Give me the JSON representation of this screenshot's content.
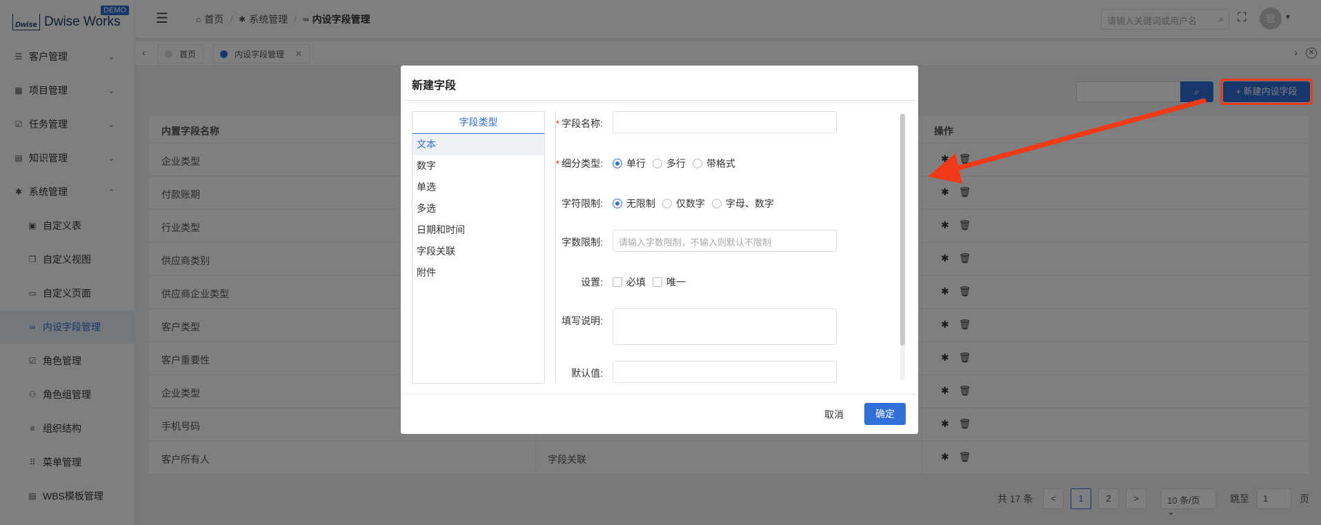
{
  "app": {
    "brand": "Dwise Works",
    "brand_mark": "Dwise",
    "demo_badge": "DEMO"
  },
  "sidebar": {
    "items": [
      {
        "label": "客户管理",
        "icon": "list-icon",
        "chevron": "down"
      },
      {
        "label": "项目管理",
        "icon": "grid-icon",
        "chevron": "down"
      },
      {
        "label": "任务管理",
        "icon": "checkbox-icon",
        "chevron": "down"
      },
      {
        "label": "知识管理",
        "icon": "book-icon",
        "chevron": "down"
      },
      {
        "label": "系统管理",
        "icon": "gear-icon",
        "chevron": "up"
      }
    ],
    "sub_items": [
      {
        "label": "自定义表",
        "icon": "doc-icon"
      },
      {
        "label": "自定义视图",
        "icon": "copy-icon"
      },
      {
        "label": "自定义页面",
        "icon": "window-icon"
      },
      {
        "label": "内设字段管理",
        "icon": "link-icon",
        "active": true
      },
      {
        "label": "角色管理",
        "icon": "check-square-icon"
      },
      {
        "label": "角色组管理",
        "icon": "users-icon"
      },
      {
        "label": "组织结构",
        "icon": "lines-icon"
      },
      {
        "label": "菜单管理",
        "icon": "apps-icon"
      },
      {
        "label": "WBS模板管理",
        "icon": "lock-icon"
      }
    ]
  },
  "header": {
    "breadcrumb": [
      {
        "label": "首页",
        "icon": "home-icon"
      },
      {
        "label": "系统管理",
        "icon": "gear-icon"
      },
      {
        "label": "内设字段管理",
        "icon": "link-icon"
      }
    ],
    "search_placeholder": "请输入关键词或用户名",
    "avatar_text": "管"
  },
  "tabs": [
    {
      "label": "首页"
    },
    {
      "label": "内设字段管理"
    }
  ],
  "toolbar": {
    "new_button": "+ 新建内设字段"
  },
  "table": {
    "headers": [
      "内置字段名称",
      "",
      "操作"
    ],
    "rows": [
      {
        "name": "企业类型",
        "type": ""
      },
      {
        "name": "付款账期",
        "type": ""
      },
      {
        "name": "行业类型",
        "type": ""
      },
      {
        "name": "供应商类别",
        "type": ""
      },
      {
        "name": "供应商企业类型",
        "type": ""
      },
      {
        "name": "客户类型",
        "type": ""
      },
      {
        "name": "客户重要性",
        "type": ""
      },
      {
        "name": "企业类型",
        "type": ""
      },
      {
        "name": "手机号码",
        "type": ""
      },
      {
        "name": "客户所有人",
        "type": "字段关联"
      }
    ]
  },
  "pagination": {
    "total": "共 17 条",
    "pages": [
      "1",
      "2"
    ],
    "prev": "<",
    "next": ">",
    "page_size": "10 条/页",
    "jump_label": "跳至",
    "jump_value": "1",
    "page_label": "页"
  },
  "modal": {
    "title": "新建字段",
    "type_list_header": "字段类型",
    "types": [
      "文本",
      "数字",
      "单选",
      "多选",
      "日期和时间",
      "字段关联",
      "附件"
    ],
    "form": {
      "name_label": "字段名称:",
      "subtype_label": "细分类型:",
      "subtype_options": [
        "单行",
        "多行",
        "带格式"
      ],
      "char_limit_label": "字符限制:",
      "char_limit_options": [
        "无限制",
        "仅数字",
        "字母、数字"
      ],
      "word_limit_label": "字数限制:",
      "word_limit_placeholder": "请输入字数限制，不输入则默认不限制",
      "settings_label": "设置:",
      "settings_options": [
        "必填",
        "唯一"
      ],
      "desc_label": "填写说明:",
      "default_label": "默认值:"
    },
    "cancel": "取消",
    "ok": "确定"
  },
  "colors": {
    "primary": "#2f6fd6",
    "annotation": "#f03a17"
  }
}
